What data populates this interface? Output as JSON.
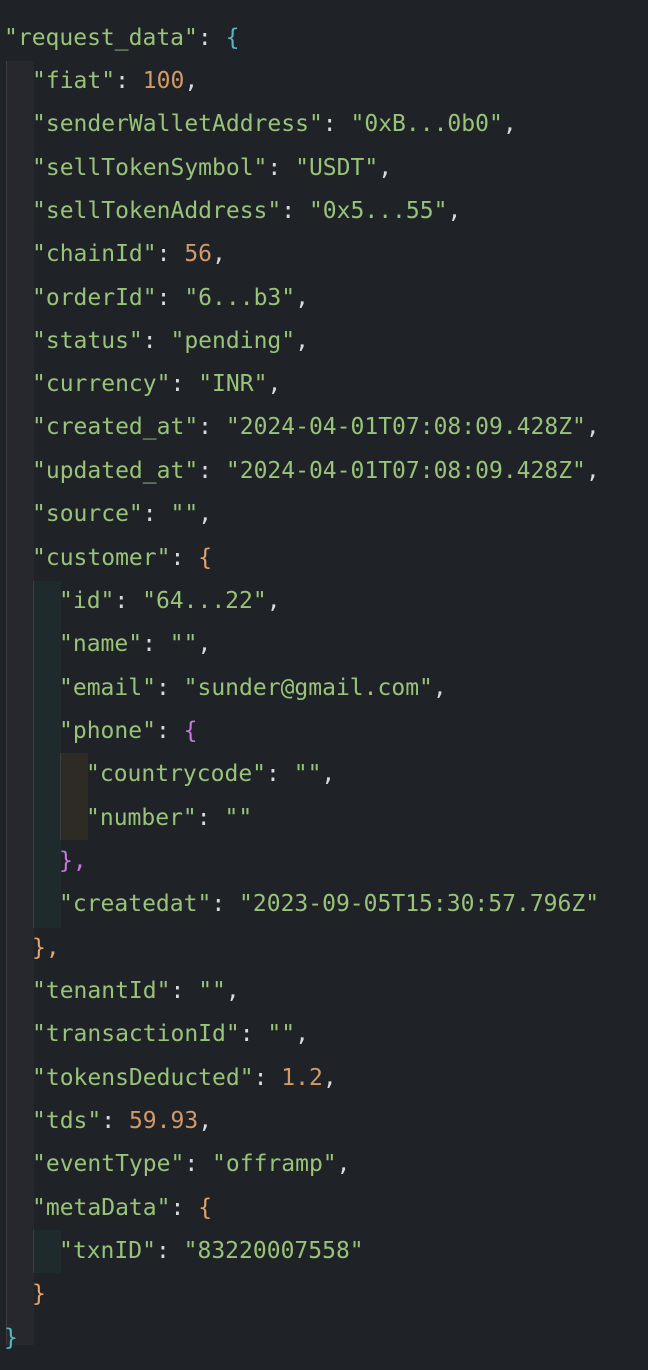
{
  "editor": {
    "root_key": "\"request_data\"",
    "open_brace": "{",
    "close_brace": "}",
    "lines": [
      {
        "key": "\"fiat\"",
        "value": "100",
        "type": "num",
        "comma": ","
      },
      {
        "key": "\"senderWalletAddress\"",
        "value": "\"0xB...0b0\"",
        "type": "str",
        "comma": ","
      },
      {
        "key": "\"sellTokenSymbol\"",
        "value": "\"USDT\"",
        "type": "str",
        "comma": ","
      },
      {
        "key": "\"sellTokenAddress\"",
        "value": "\"0x5...55\"",
        "type": "str",
        "comma": ","
      },
      {
        "key": "\"chainId\"",
        "value": "56",
        "type": "num",
        "comma": ","
      },
      {
        "key": "\"orderId\"",
        "value": "\"6...b3\"",
        "type": "str",
        "comma": ","
      },
      {
        "key": "\"status\"",
        "value": "\"pending\"",
        "type": "str",
        "comma": ","
      },
      {
        "key": "\"currency\"",
        "value": "\"INR\"",
        "type": "str",
        "comma": ","
      },
      {
        "key": "\"created_at\"",
        "value": "\"2024-04-01T07:08:09.428Z\"",
        "type": "str",
        "comma": ","
      },
      {
        "key": "\"updated_at\"",
        "value": "\"2024-04-01T07:08:09.428Z\"",
        "type": "str",
        "comma": ","
      },
      {
        "key": "\"source\"",
        "value": "\"\"",
        "type": "str",
        "comma": ","
      }
    ],
    "customer": {
      "key": "\"customer\"",
      "open": "{",
      "close": "},",
      "id_key": "\"id\"",
      "id_value": "\"64...22\"",
      "name_key": "\"name\"",
      "name_value": "\"\"",
      "email_key": "\"email\"",
      "email_value": "\"sunder@gmail.com\"",
      "phone": {
        "key": "\"phone\"",
        "open": "{",
        "close": "},",
        "countrycode_key": "\"countrycode\"",
        "countrycode_value": "\"\"",
        "number_key": "\"number\"",
        "number_value": "\"\""
      },
      "createdat_key": "\"createdat\"",
      "createdat_value": "\"2023-09-05T15:30:57.796Z\""
    },
    "after_lines": [
      {
        "key": "\"tenantId\"",
        "value": "\"\"",
        "type": "str",
        "comma": ","
      },
      {
        "key": "\"transactionId\"",
        "value": "\"\"",
        "type": "str",
        "comma": ","
      },
      {
        "key": "\"tokensDeducted\"",
        "value": "1.2",
        "type": "num",
        "comma": ","
      },
      {
        "key": "\"tds\"",
        "value": "59.93",
        "type": "num",
        "comma": ","
      },
      {
        "key": "\"eventType\"",
        "value": "\"offramp\"",
        "type": "str",
        "comma": ","
      }
    ],
    "metaData": {
      "key": "\"metaData\"",
      "open": "{",
      "close": "}",
      "txnID_key": "\"txnID\"",
      "txnID_value": "\"83220007558\""
    }
  },
  "colors": {
    "background": "#1f2227",
    "key_string": "#98c379",
    "number": "#d19a66",
    "bracket_level1": "#56b6c2",
    "bracket_level2": "#e5a36a",
    "bracket_level3": "#c678dd"
  }
}
